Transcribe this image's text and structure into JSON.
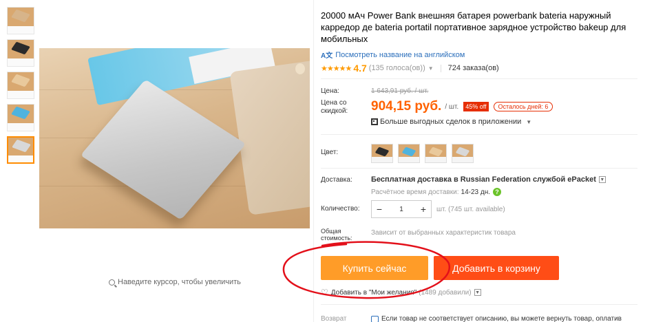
{
  "thumbnails": [
    {
      "bg": "#d9a870",
      "device": "#d7b48a"
    },
    {
      "bg": "#d9a870",
      "device": "#2b2b2b"
    },
    {
      "bg": "#d9a870",
      "device": "#e9c99c"
    },
    {
      "bg": "#d9a870",
      "device": "#4fb3de"
    },
    {
      "bg": "#d9a870",
      "device": "#d8d8d8"
    }
  ],
  "zoom_hint": "Наведите курсор, чтобы увеличить",
  "product": {
    "title": "20000 мАч Power Bank внешняя батарея powerbank bateria наружный карредор де bateria portatil портативное зарядное устройство bakeup для мобильных",
    "translate_link": "Посмотреть название на английском",
    "stars": "★★★★★",
    "rating": "4.7",
    "votes": "(135 голоса(ов))",
    "orders": "724 заказа(ов)"
  },
  "price": {
    "label": "Цена:",
    "old": "1 643,91 руб. / шт.",
    "discount_label": "Цена со скидкой:",
    "new_amount": "904,15 руб.",
    "unit": "/ шт.",
    "discount_badge": "45% off",
    "days_left": "Осталось дней: 6",
    "app_deals": "Больше выгодных сделок в приложении"
  },
  "color": {
    "label": "Цвет:",
    "swatches": [
      {
        "bg": "#d9a870",
        "device": "#2b2b2b"
      },
      {
        "bg": "#d9a870",
        "device": "#4fb3de"
      },
      {
        "bg": "#d9a870",
        "device": "#e9c99c"
      },
      {
        "bg": "#d9a870",
        "device": "#d8d8d8"
      }
    ]
  },
  "shipping": {
    "label": "Доставка:",
    "main": "Бесплатная доставка в Russian Federation службой ePacket",
    "time_label": "Расчётное время доставки:",
    "time_value": "14-23 дн."
  },
  "quantity": {
    "label": "Количество:",
    "minus": "−",
    "value": "1",
    "plus": "+",
    "available": "шт. (745 шт. available)"
  },
  "total": {
    "label": "Общая стоимость:",
    "hint": "Зависит от выбранных характеристик товара"
  },
  "buttons": {
    "buy_now": "Купить сейчас",
    "add_to_cart": "Добавить в корзину"
  },
  "wishlist": {
    "text": "Добавить в \"Мои желания\"",
    "count": "(1489 добавили)"
  },
  "returns": {
    "label": "Возврат",
    "text": "Если товар не соответствует описанию, вы можете вернуть товар, оплатив"
  },
  "colors": {
    "accent_orange": "#ff6200",
    "buy_now_bg": "#ff9c28",
    "cart_bg": "#ff4d16",
    "annotation_red": "#e3101a",
    "link_blue": "#2a6ebb"
  }
}
